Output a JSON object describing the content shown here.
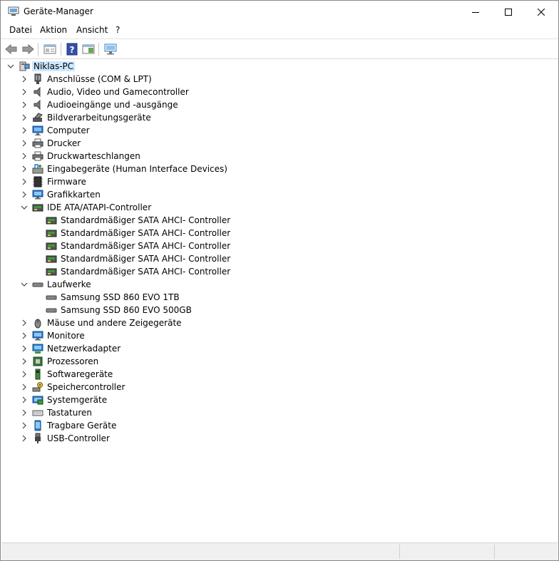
{
  "window": {
    "title": "Geräte-Manager"
  },
  "menu": [
    "Datei",
    "Aktion",
    "Ansicht",
    "?"
  ],
  "tree": {
    "root": "Niklas-PC",
    "categories": [
      {
        "label": "Anschlüsse (COM & LPT)",
        "icon": "port-icon"
      },
      {
        "label": "Audio, Video und Gamecontroller",
        "icon": "speaker-icon"
      },
      {
        "label": "Audioeingänge und -ausgänge",
        "icon": "speaker-icon"
      },
      {
        "label": "Bildverarbeitungsgeräte",
        "icon": "camera-icon"
      },
      {
        "label": "Computer",
        "icon": "computer-icon"
      },
      {
        "label": "Drucker",
        "icon": "printer-icon"
      },
      {
        "label": "Druckwarteschlangen",
        "icon": "printer-icon"
      },
      {
        "label": "Eingabegeräte (Human Interface Devices)",
        "icon": "hid-icon"
      },
      {
        "label": "Firmware",
        "icon": "chip-icon"
      },
      {
        "label": "Grafikkarten",
        "icon": "monitor-icon"
      },
      {
        "label": "IDE ATA/ATAPI-Controller",
        "icon": "controller-icon",
        "expanded": true,
        "children": [
          "Standardmäßiger SATA AHCI- Controller",
          "Standardmäßiger SATA AHCI- Controller",
          "Standardmäßiger SATA AHCI- Controller",
          "Standardmäßiger SATA AHCI- Controller",
          "Standardmäßiger SATA AHCI- Controller"
        ]
      },
      {
        "label": "Laufwerke",
        "icon": "drive-icon",
        "expanded": true,
        "children": [
          "Samsung SSD 860 EVO 1TB",
          "Samsung SSD 860 EVO 500GB"
        ]
      },
      {
        "label": "Mäuse und andere Zeigegeräte",
        "icon": "mouse-icon"
      },
      {
        "label": "Monitore",
        "icon": "monitor-icon"
      },
      {
        "label": "Netzwerkadapter",
        "icon": "network-icon"
      },
      {
        "label": "Prozessoren",
        "icon": "processor-icon"
      },
      {
        "label": "Softwaregeräte",
        "icon": "software-icon"
      },
      {
        "label": "Speichercontroller",
        "icon": "storage-controller-icon"
      },
      {
        "label": "Systemgeräte",
        "icon": "system-icon"
      },
      {
        "label": "Tastaturen",
        "icon": "keyboard-icon"
      },
      {
        "label": "Tragbare Geräte",
        "icon": "portable-icon"
      },
      {
        "label": "USB-Controller",
        "icon": "usb-icon"
      }
    ]
  },
  "colors": {
    "selection": "#cce8ff",
    "icon_blue": "#2b7cd3",
    "icon_green": "#3a9a3a"
  }
}
